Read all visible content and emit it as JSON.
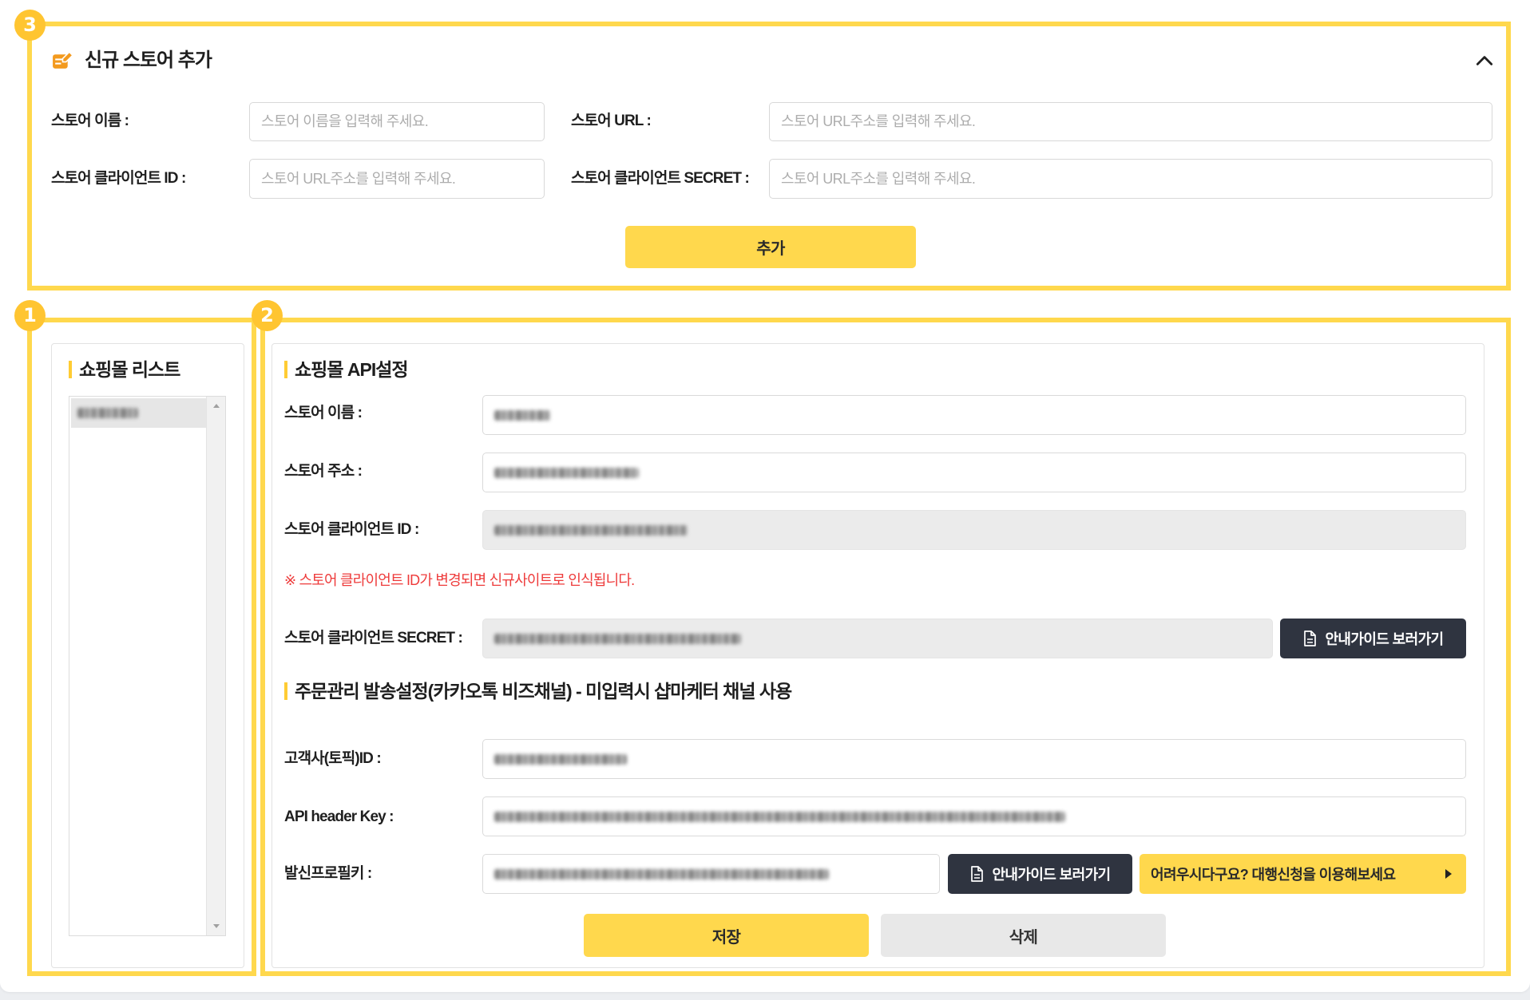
{
  "badges": {
    "new_store": "3",
    "store_list": "1",
    "api_settings": "2"
  },
  "new_store": {
    "title": "신규 스토어 추가",
    "name_label": "스토어 이름 :",
    "name_placeholder": "스토어 이름을 입력해 주세요.",
    "url_label": "스토어 URL :",
    "url_placeholder": "스토어 URL주소를 입력해 주세요.",
    "client_id_label": "스토어 클라이언트 ID :",
    "client_id_placeholder": "스토어 URL주소를 입력해 주세요.",
    "secret_label": "스토어 클라이언트 SECRET :",
    "secret_placeholder": "스토어 URL주소를 입력해 주세요.",
    "add_button": "추가"
  },
  "store_list": {
    "title": "쇼핑몰 리스트"
  },
  "api_settings": {
    "title": "쇼핑몰 API설정",
    "store_name_label": "스토어 이름 :",
    "store_address_label": "스토어 주소 :",
    "client_id_label": "스토어 클라이언트 ID :",
    "client_id_warning": "※ 스토어 클라이언트 ID가 변경되면 신규사이트로 인식됩니다.",
    "secret_label": "스토어 클라이언트 SECRET :",
    "guide_button": "안내가이드 보러가기"
  },
  "order_settings": {
    "title": "주문관리 발송설정(카카오톡 비즈채널) - 미입력시 샵마케터 채널 사용",
    "topic_id_label": "고객사(토픽)ID :",
    "api_header_key_label": "API header Key :",
    "sender_profile_key_label": "발신프로필키 :",
    "guide_button": "안내가이드 보러가기",
    "agency_button": "어려우시다구요? 대행신청을 이용해보세요"
  },
  "actions": {
    "save": "저장",
    "delete": "삭제"
  },
  "icons": {
    "header": "store-edit-icon",
    "collapse": "chevron-up-icon",
    "guide": "document-icon",
    "agency": "caret-right-icon"
  },
  "colors": {
    "highlight": "#FFD84D",
    "badge": "#FFC531",
    "dark": "#2F3440",
    "warning": "#EE3B3B",
    "title_bar": "#FFCC33",
    "header_icon": "#F39A1E"
  }
}
